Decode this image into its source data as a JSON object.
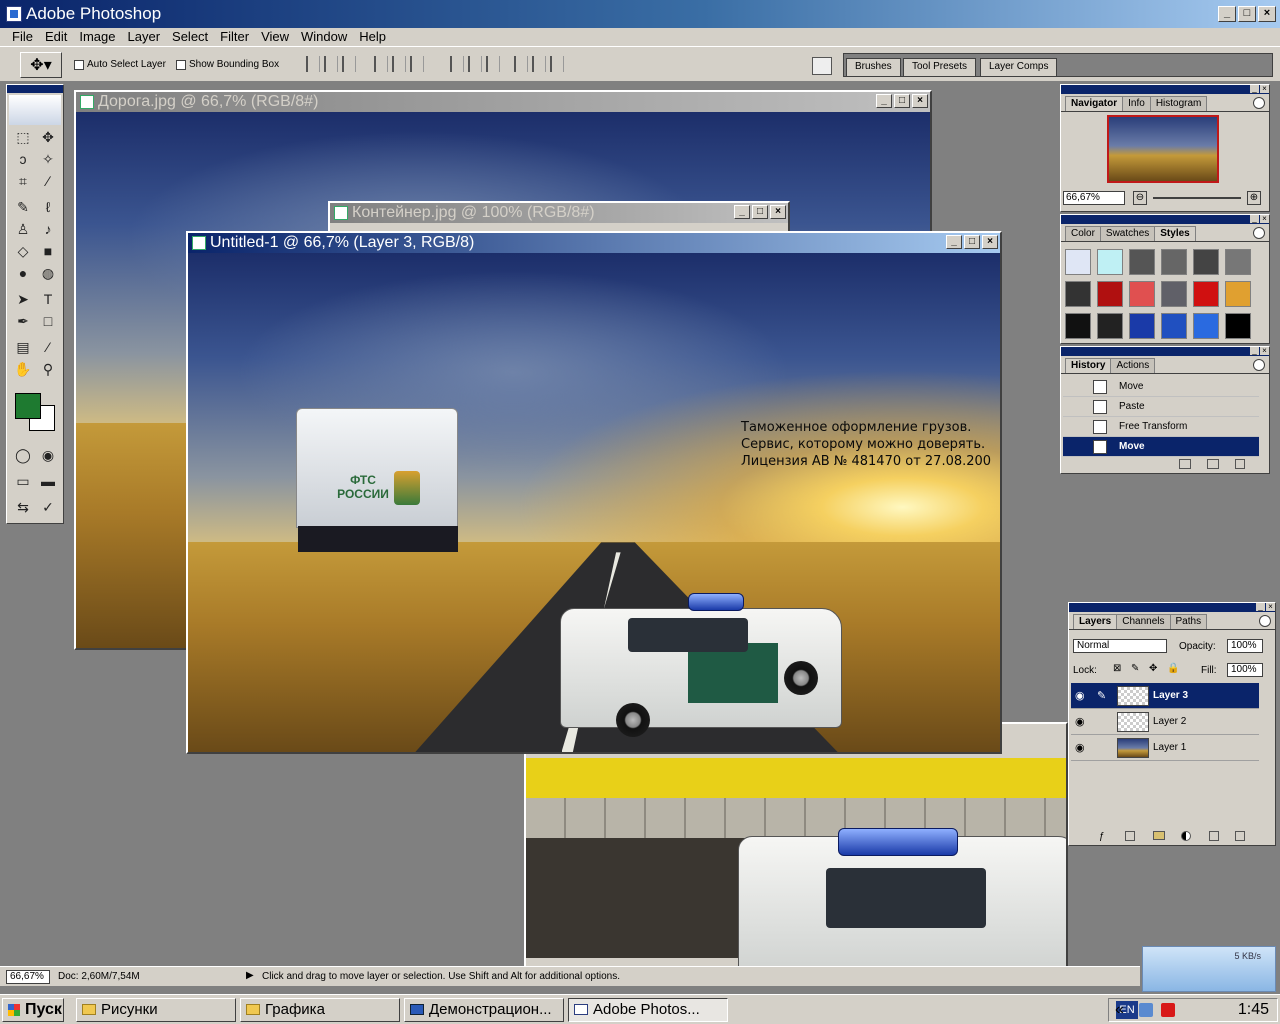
{
  "app": {
    "title": "Adobe Photoshop"
  },
  "menu": [
    "File",
    "Edit",
    "Image",
    "Layer",
    "Select",
    "Filter",
    "View",
    "Window",
    "Help"
  ],
  "options": {
    "auto_select": "Auto Select Layer",
    "bounding_box": "Show Bounding Box"
  },
  "well_tabs": [
    "Brushes",
    "Tool Presets",
    "Layer Comps"
  ],
  "docs": {
    "doroga": "Дорога.jpg @ 66,7% (RGB/8#)",
    "container": "Контейнер.jpg @ 100% (RGB/8#)",
    "untitled": "Untitled-1 @ 66,7% (Layer 3, RGB/8)"
  },
  "canvas_text": {
    "line1": "Таможенное оформление грузов.",
    "line2": "Сервис, которому можно доверять.",
    "line3": "Лицензия АВ № 481470 от 27.08.200"
  },
  "container_label": {
    "line1": "ФТС",
    "line2": "РОССИИ"
  },
  "navigator": {
    "tabs": [
      "Navigator",
      "Info",
      "Histogram"
    ],
    "zoom": "66,67%"
  },
  "styles_panel": {
    "tabs": [
      "Color",
      "Swatches",
      "Styles"
    ]
  },
  "history": {
    "tabs": [
      "History",
      "Actions"
    ],
    "items": [
      "Move",
      "Paste",
      "Free Transform",
      "Move"
    ]
  },
  "layers": {
    "tabs": [
      "Layers",
      "Channels",
      "Paths"
    ],
    "blend": "Normal",
    "opacity_label": "Opacity:",
    "opacity": "100%",
    "lock_label": "Lock:",
    "fill_label": "Fill:",
    "fill": "100%",
    "items": [
      "Layer 3",
      "Layer 2",
      "Layer 1"
    ]
  },
  "status": {
    "zoom": "66,67%",
    "doc": "Doc: 2,60M/7,54M",
    "hint": "Click and drag to move layer or selection.  Use Shift and Alt for additional options."
  },
  "taskbar": {
    "start": "Пуск",
    "buttons": [
      "Рисунки",
      "Графика",
      "Демонстрацион...",
      "Adobe Photos..."
    ],
    "lang": "EN",
    "clock": "1:45"
  },
  "net_speed": "5 KB/s",
  "colors": {
    "fg": "#1e7a30",
    "bg": "#ffffff",
    "title_active": "#0a246a"
  }
}
